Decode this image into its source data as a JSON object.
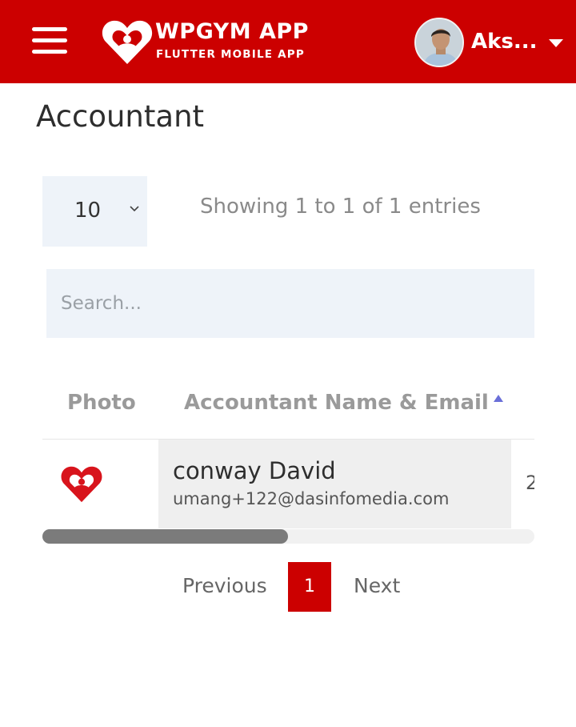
{
  "header": {
    "app_title": "WPGYM APP",
    "app_subtitle": "FLUTTER MOBILE APP",
    "user_name": "Aks...",
    "brand_color": "#cc0000"
  },
  "page": {
    "title": "Accountant"
  },
  "table_controls": {
    "entries_value": "10",
    "info_text": "Showing 1 to 1 of 1 entries",
    "search_placeholder": "Search..."
  },
  "table": {
    "columns": [
      "Photo",
      "Accountant Name & Email"
    ],
    "sort": "ascending",
    "rows": [
      {
        "photo_icon": "wpgym-heart-logo",
        "name": "conway David",
        "email": "umang+122@dasinfomedia.com",
        "next_cell_text": "2"
      }
    ]
  },
  "pagination": {
    "previous_label": "Previous",
    "current_page": "1",
    "next_label": "Next"
  }
}
